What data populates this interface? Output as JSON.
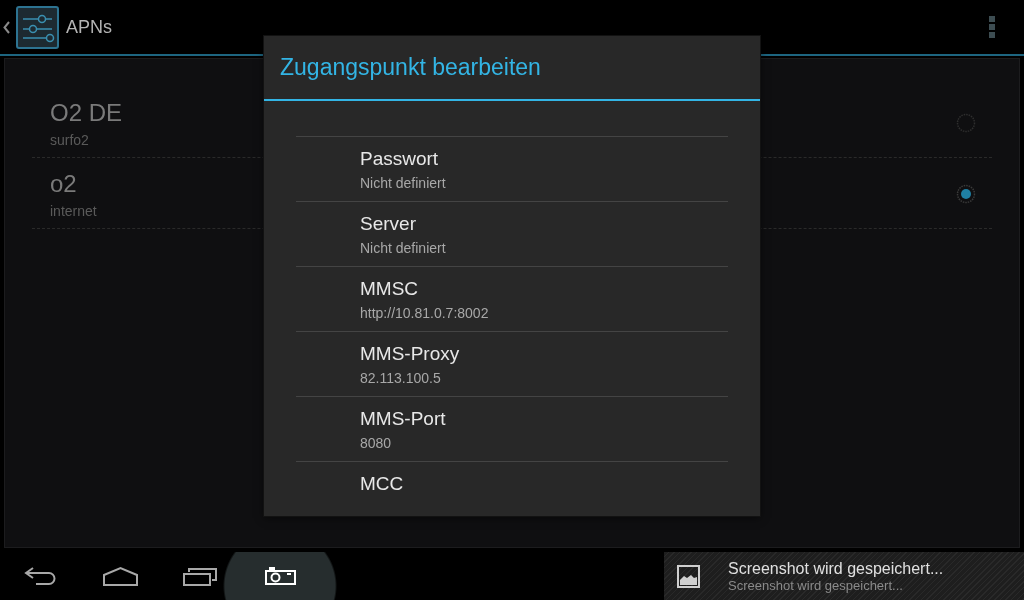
{
  "action_bar": {
    "title": "APNs"
  },
  "apn_list": [
    {
      "name": "O2 DE",
      "apn": "surfo2",
      "selected": false
    },
    {
      "name": "o2",
      "apn": "internet",
      "selected": true
    }
  ],
  "dialog": {
    "title": "Zugangspunkt bearbeiten",
    "preferences": [
      {
        "title": "Passwort",
        "summary": "Nicht definiert"
      },
      {
        "title": "Server",
        "summary": "Nicht definiert"
      },
      {
        "title": "MMSC",
        "summary": "http://10.81.0.7:8002"
      },
      {
        "title": "MMS-Proxy",
        "summary": "82.113.100.5"
      },
      {
        "title": "MMS-Port",
        "summary": "8080"
      },
      {
        "title": "MCC"
      }
    ]
  },
  "notification": {
    "title": "Screenshot wird gespeichert...",
    "text": "Screenshot wird gespeichert..."
  }
}
